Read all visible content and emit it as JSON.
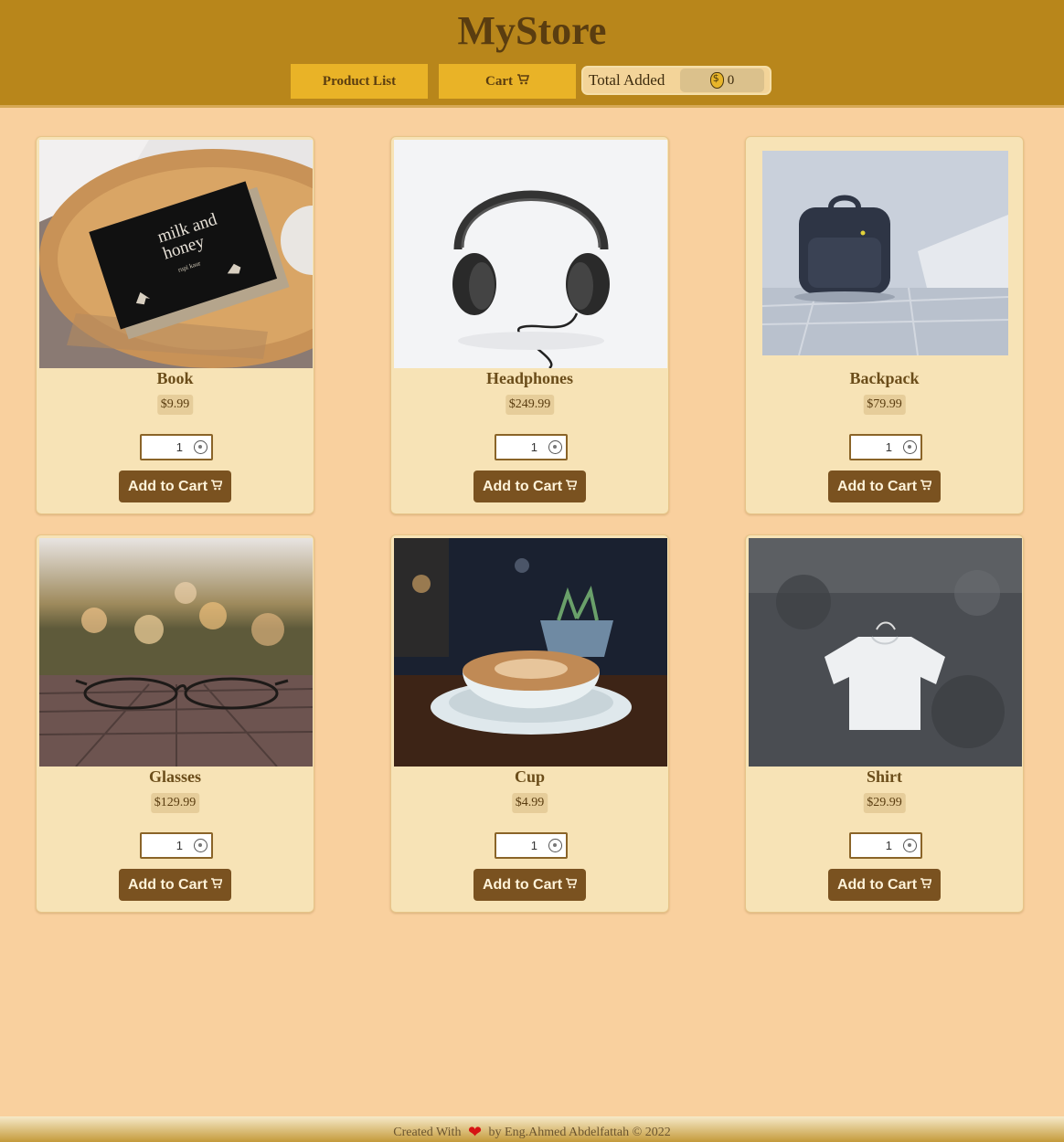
{
  "header": {
    "brand": "MyStore",
    "nav": {
      "product_list_label": "Product List",
      "cart_label": "Cart",
      "cart_icon": "cart-icon"
    },
    "total": {
      "label": "Total Added",
      "icon": "money-bag-icon",
      "value": "0"
    }
  },
  "products": [
    {
      "name": "Book",
      "price": "$9.99",
      "qty": "1",
      "add_label": "Add to Cart",
      "image": "book-photo"
    },
    {
      "name": "Headphones",
      "price": "$249.99",
      "qty": "1",
      "add_label": "Add to Cart",
      "image": "headphones-photo"
    },
    {
      "name": "Backpack",
      "price": "$79.99",
      "qty": "1",
      "add_label": "Add to Cart",
      "image": "backpack-photo"
    },
    {
      "name": "Glasses",
      "price": "$129.99",
      "qty": "1",
      "add_label": "Add to Cart",
      "image": "glasses-photo"
    },
    {
      "name": "Cup",
      "price": "$4.99",
      "qty": "1",
      "add_label": "Add to Cart",
      "image": "cup-photo"
    },
    {
      "name": "Shirt",
      "price": "$29.99",
      "qty": "1",
      "add_label": "Add to Cart",
      "image": "shirt-photo"
    }
  ],
  "footer": {
    "prefix": "Created With",
    "suffix": "by Eng.Ahmed Abdelfattah © 2022"
  },
  "colors": {
    "header_bg": "#b8861b",
    "page_bg": "#f9d09e",
    "nav_button": "#e9b327",
    "card_bg": "#f7e3b6",
    "add_button": "#7a5220"
  }
}
